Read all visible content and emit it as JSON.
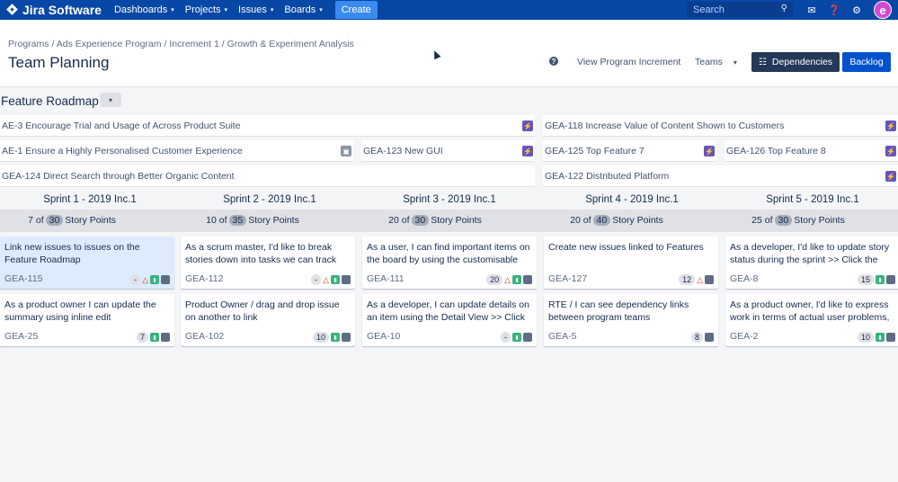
{
  "nav": {
    "brand": "Jira Software",
    "items": [
      {
        "label": "Dashboards",
        "caret": "▾"
      },
      {
        "label": "Projects",
        "caret": "▾"
      },
      {
        "label": "Issues",
        "caret": "▾"
      },
      {
        "label": "Boards",
        "caret": "▾"
      }
    ],
    "create_label": "Create",
    "search_placeholder": "Search",
    "icons": [
      "megaphone-icon",
      "help-icon",
      "settings-icon"
    ],
    "avatar_letter": "e"
  },
  "breadcrumbs": [
    "Programs",
    "/ Ads Experience Program",
    "/ Increment 1",
    "/ Growth & Experiment Analysis"
  ],
  "page_title": "Team Planning",
  "header": {
    "help_glyph": "?",
    "view_increment_label": "View Program Increment",
    "teams_label": "Teams",
    "teams_caret": "▾",
    "dependencies_label": "Dependencies",
    "backlog_label": "Backlog"
  },
  "roadmap": {
    "title": "Feature Roadmap",
    "toggle": "▾",
    "features": [
      {
        "text": "AE-3 Encourage Trial and Usage of Across Product Suite",
        "icon": "epic"
      },
      {
        "text": "GEA-118 Increase Value of Content Shown to Customers",
        "icon": "epic"
      },
      {
        "text": "AE-1 Ensure a Highly Personalised Customer Experience",
        "icon": "grey"
      },
      {
        "text": "GEA-123 New GUI",
        "icon": "epic"
      },
      {
        "text": "GEA-125 Top Feature 7",
        "icon": "epic"
      },
      {
        "text": "GEA-126 Top Feature 8",
        "icon": "epic"
      },
      {
        "text": "GEA-124 Direct Search through Better Organic Content",
        "icon": "epic"
      },
      {
        "text": "GEA-122 Distributed Platform",
        "icon": "epic"
      }
    ]
  },
  "sprints": [
    {
      "name": "Sprint 1 - 2019 Inc.1",
      "used": "7 of",
      "capacity": "30",
      "unit": "Story Points"
    },
    {
      "name": "Sprint 2 - 2019 Inc.1",
      "used": "10 of",
      "capacity": "35",
      "unit": "Story Points"
    },
    {
      "name": "Sprint 3 - 2019 Inc.1",
      "used": "20 of",
      "capacity": "30",
      "unit": "Story Points"
    },
    {
      "name": "Sprint 4 - 2019 Inc.1",
      "used": "20 of",
      "capacity": "40",
      "unit": "Story Points"
    },
    {
      "name": "Sprint 5 - 2019 Inc.1",
      "used": "25 of",
      "capacity": "30",
      "unit": "Story Points"
    }
  ],
  "cards": [
    {
      "summary": "Link new issues to issues on the Feature Roadmap",
      "key": "GEA-115",
      "estimate": "-",
      "dependency": true,
      "selected": true
    },
    {
      "summary": "As a scrum master, I'd like to break stories down into tasks we can track",
      "key": "GEA-112",
      "estimate": "-",
      "dependency": true,
      "selected": false
    },
    {
      "summary": "As a user, I can find important items on the board by using the customisable",
      "key": "GEA-111",
      "estimate": "20",
      "dependency": true,
      "selected": false
    },
    {
      "summary": "Create new issues linked to Features",
      "key": "GEA-127",
      "estimate": "12",
      "dependency": true,
      "selected": false
    },
    {
      "summary": "As a developer, I'd like to update story status during the sprint >> Click the",
      "key": "GEA-8",
      "estimate": "15",
      "dependency": false,
      "selected": false
    },
    {
      "summary": "As a product owner I can update the summary using inline edit",
      "key": "GEA-25",
      "estimate": "7",
      "dependency": false,
      "selected": false
    },
    {
      "summary": "Product Owner / drag and drop issue on another to link",
      "key": "GEA-102",
      "estimate": "10",
      "dependency": false,
      "selected": false
    },
    {
      "summary": "As a developer, I can update details on an item using the Detail View >> Click",
      "key": "GEA-10",
      "estimate": "-",
      "dependency": false,
      "selected": false
    },
    {
      "summary": "RTE / I can see dependency links between program teams",
      "key": "GEA-5",
      "estimate": "8",
      "dependency": false,
      "selected": false
    },
    {
      "summary": "As a product owner, I'd like to express work in terms of actual user problems,",
      "key": "GEA-2",
      "estimate": "10",
      "dependency": false,
      "selected": false
    }
  ],
  "colors": {
    "nav_bg": "#0747a6",
    "primary": "#0052cc",
    "dark_button": "#253858",
    "epic": "#6554c0",
    "story": "#36b37e",
    "selected_card": "#deebff"
  }
}
